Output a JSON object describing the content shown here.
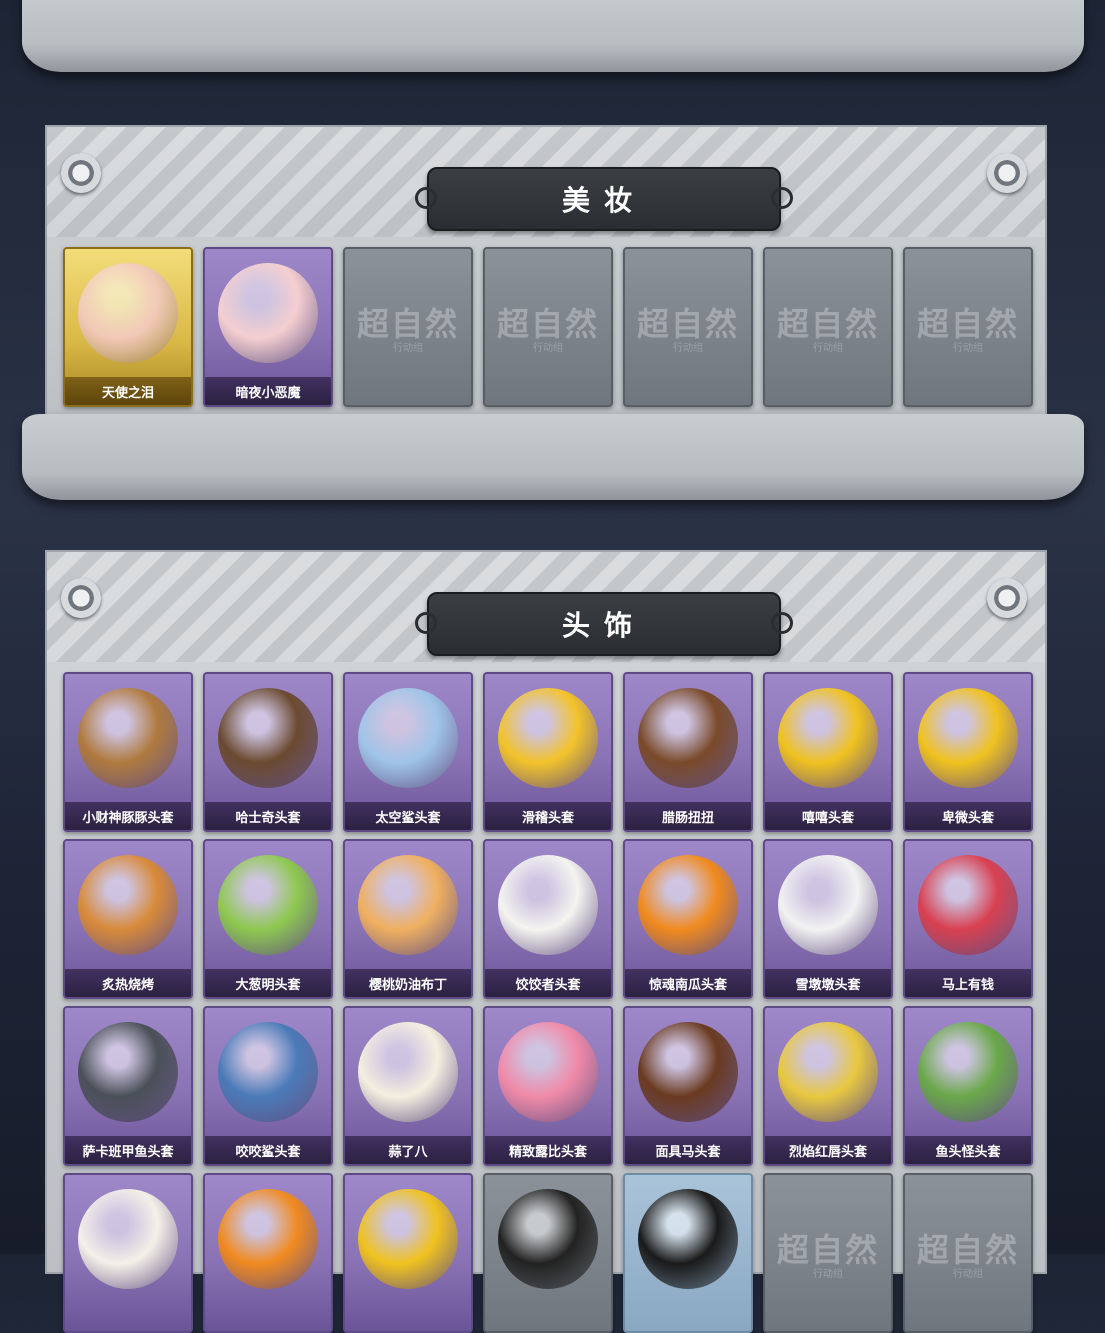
{
  "sections": [
    {
      "title": "美妆",
      "items": [
        {
          "label": "天使之泪",
          "style": "gold",
          "color": "#f2c9b8"
        },
        {
          "label": "暗夜小恶魔",
          "style": "purple",
          "color": "#f4cfd0"
        },
        {
          "label": "",
          "style": "grey",
          "locked": true
        },
        {
          "label": "",
          "style": "grey",
          "locked": true
        },
        {
          "label": "",
          "style": "grey",
          "locked": true
        },
        {
          "label": "",
          "style": "grey",
          "locked": true
        },
        {
          "label": "",
          "style": "grey",
          "locked": true
        }
      ]
    },
    {
      "title": "头饰",
      "items": [
        {
          "label": "小财神豚豚头套",
          "style": "purple",
          "color": "#b07a3e"
        },
        {
          "label": "哈士奇头套",
          "style": "purple",
          "color": "#6b4a30"
        },
        {
          "label": "太空鲨头套",
          "style": "purple",
          "color": "#9fc4e8"
        },
        {
          "label": "滑稽头套",
          "style": "purple",
          "color": "#f3c32a"
        },
        {
          "label": "腊肠扭扭",
          "style": "purple",
          "color": "#7a4a2a"
        },
        {
          "label": "嘻嘻头套",
          "style": "purple",
          "color": "#f0c21f"
        },
        {
          "label": "卑微头套",
          "style": "purple",
          "color": "#f0c21f"
        },
        {
          "label": "炙热烧烤",
          "style": "purple",
          "color": "#d88a3a"
        },
        {
          "label": "大葱明头套",
          "style": "purple",
          "color": "#8ec850"
        },
        {
          "label": "樱桃奶油布丁",
          "style": "purple",
          "color": "#f0b060"
        },
        {
          "label": "饺饺者头套",
          "style": "purple",
          "color": "#f4f4f0"
        },
        {
          "label": "惊魂南瓜头套",
          "style": "purple",
          "color": "#f08a1e"
        },
        {
          "label": "雪墩墩头套",
          "style": "purple",
          "color": "#f2f2f2"
        },
        {
          "label": "马上有钱",
          "style": "purple",
          "color": "#d84050"
        },
        {
          "label": "萨卡班甲鱼头套",
          "style": "purple",
          "color": "#4a5058"
        },
        {
          "label": "咬咬鲨头套",
          "style": "purple",
          "color": "#4a7ab8"
        },
        {
          "label": "蒜了八",
          "style": "purple",
          "color": "#f4efe0"
        },
        {
          "label": "精致露比头套",
          "style": "purple",
          "color": "#f08aa8"
        },
        {
          "label": "面具马头套",
          "style": "purple",
          "color": "#6a3a20"
        },
        {
          "label": "烈焰红唇头套",
          "style": "purple",
          "color": "#e8c840"
        },
        {
          "label": "鱼头怪头套",
          "style": "purple",
          "color": "#6aa84a"
        },
        {
          "label": "",
          "style": "purple",
          "color": "#f4f0e8"
        },
        {
          "label": "",
          "style": "purple",
          "color": "#f08a20"
        },
        {
          "label": "",
          "style": "purple",
          "color": "#f0c21f"
        },
        {
          "label": "",
          "style": "grey",
          "color": "#222222"
        },
        {
          "label": "",
          "style": "blue",
          "color": "#1a1a1a"
        },
        {
          "label": "",
          "style": "grey",
          "locked": true
        },
        {
          "label": "",
          "style": "grey",
          "locked": true
        }
      ]
    }
  ],
  "locked_logo": "超自然",
  "locked_logo_sub": "行动组",
  "colors": {
    "purple": "#8a73b5",
    "gold": "#d9b845",
    "banner": "#2f3236"
  }
}
